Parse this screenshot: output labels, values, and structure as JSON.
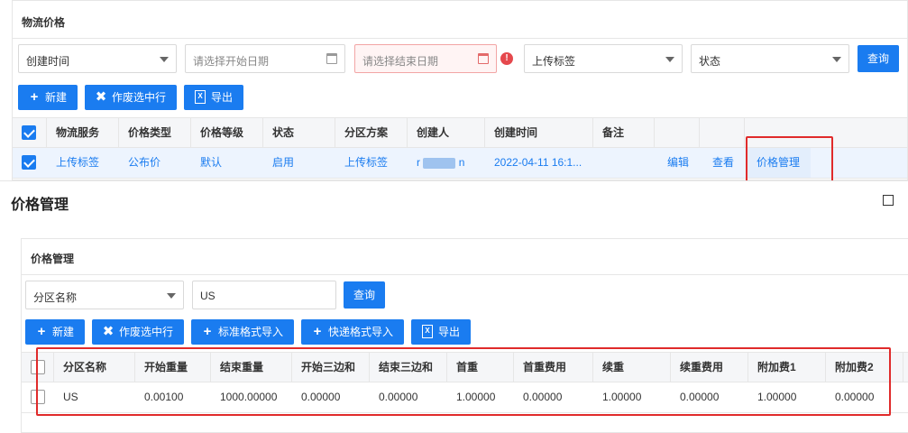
{
  "top": {
    "title": "物流价格",
    "filters": {
      "field_select": "创建时间",
      "start_placeholder": "请选择开始日期",
      "end_placeholder": "请选择结束日期",
      "tag_select": "上传标签",
      "status_select": "状态",
      "query_label": "查询",
      "error_mark": "!"
    },
    "toolbar": {
      "new_label": "新建",
      "void_label": "作废选中行",
      "export_label": "导出"
    },
    "table": {
      "headers": [
        "物流服务",
        "价格类型",
        "价格等级",
        "状态",
        "分区方案",
        "创建人",
        "创建时间",
        "备注"
      ],
      "rows": [
        {
          "cells": [
            "上传标签",
            "公布价",
            "默认",
            "启用",
            "上传标签",
            "",
            "2022-04-11 16:1...",
            ""
          ],
          "creator_prefix": "r",
          "creator_suffix": "n",
          "actions": [
            "编辑",
            "查看",
            "价格管理"
          ]
        }
      ]
    }
  },
  "dialog": {
    "title": "价格管理",
    "panel_title": "价格管理",
    "filters": {
      "field_select": "分区名称",
      "value": "US",
      "query_label": "查询"
    },
    "toolbar": {
      "new_label": "新建",
      "void_label": "作废选中行",
      "std_import_label": "标准格式导入",
      "express_import_label": "快递格式导入",
      "export_label": "导出"
    },
    "table": {
      "headers": [
        "分区名称",
        "开始重量",
        "结束重量",
        "开始三边和",
        "结束三边和",
        "首重",
        "首重费用",
        "续重",
        "续重费用",
        "附加费1",
        "附加费2"
      ],
      "rows": [
        [
          "US",
          "0.00100",
          "1000.00000",
          "0.00000",
          "0.00000",
          "1.00000",
          "0.00000",
          "1.00000",
          "0.00000",
          "1.00000",
          "0.00000"
        ]
      ]
    }
  },
  "colors": {
    "primary": "#1a7cf0",
    "highlight_box": "#e02b2b",
    "error": "#e5484d"
  }
}
